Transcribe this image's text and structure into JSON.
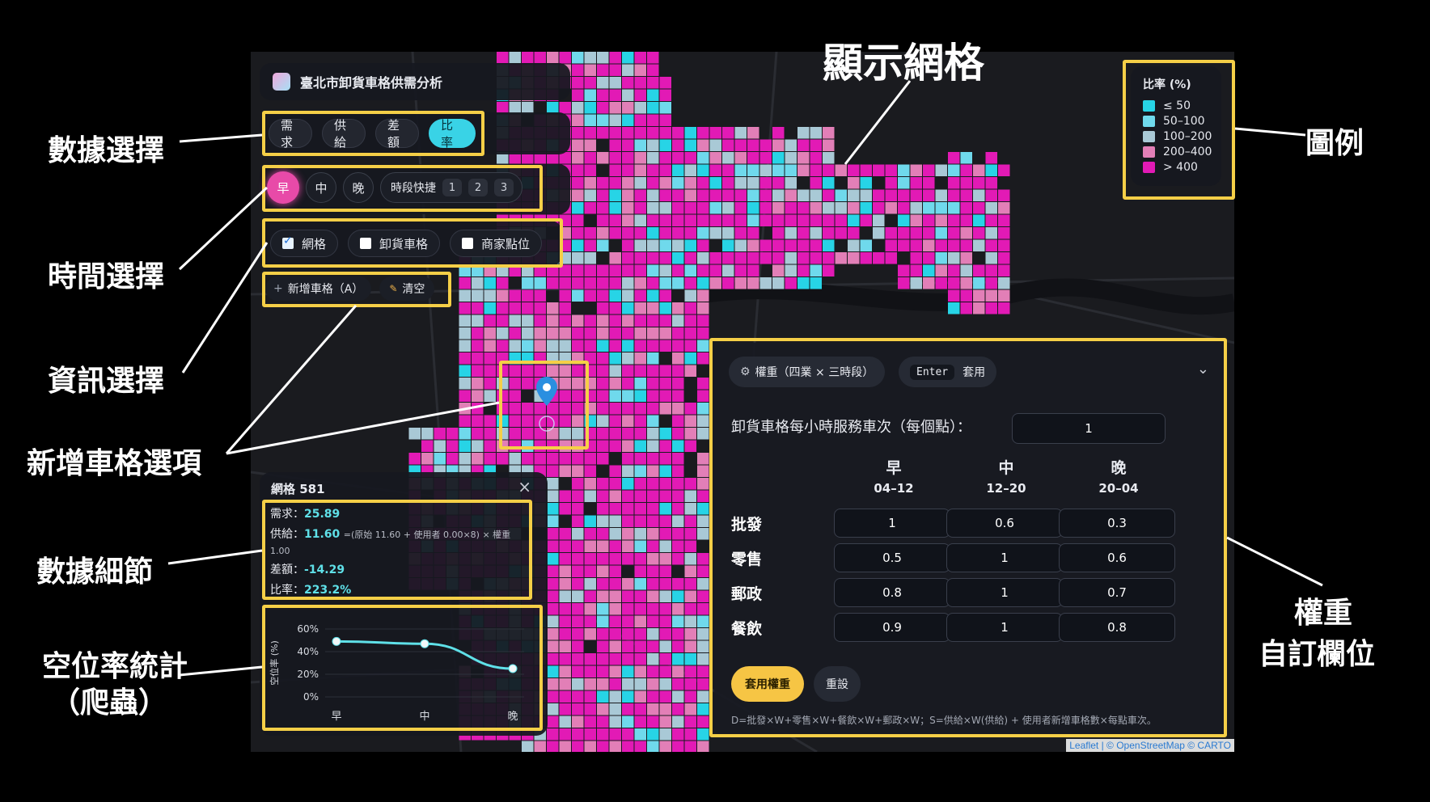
{
  "app": {
    "title": "臺北市卸貨車格供需分析"
  },
  "data_select": {
    "items": [
      "需求",
      "供給",
      "差額",
      "比率"
    ],
    "active_index": 3
  },
  "time_select": {
    "items": [
      "早",
      "中",
      "晚"
    ],
    "active_index": 0,
    "quick_label": "時段快捷",
    "quick_items": [
      "1",
      "2",
      "3"
    ]
  },
  "layers": [
    {
      "label": "網格",
      "checked": true
    },
    {
      "label": "卸貨車格",
      "checked": false
    },
    {
      "label": "商家點位",
      "checked": false
    }
  ],
  "actions": {
    "add": "新增車格（A）",
    "clear": "清空"
  },
  "legend": {
    "title": "比率 (%)",
    "items": [
      {
        "label": "≤ 50",
        "color": "#27d4e6"
      },
      {
        "label": "50–100",
        "color": "#6fd9ec"
      },
      {
        "label": "100–200",
        "color": "#a9c9d6"
      },
      {
        "label": "200–400",
        "color": "#e27fb7"
      },
      {
        "label": "> 400",
        "color": "#e21ab5"
      }
    ]
  },
  "cell_detail": {
    "title": "網格 581",
    "demand_label": "需求：",
    "demand_value": "25.89",
    "supply_label": "供給：",
    "supply_value": "11.60",
    "supply_note": "=(原始 11.60 + 使用者 0.00×8) × 權重",
    "supply_note2": "1.00",
    "diff_label": "差額：",
    "diff_value": "-14.29",
    "ratio_label": "比率：",
    "ratio_value": "223.2%"
  },
  "vacancy_chart": {
    "ylabel": "空位率 (%)",
    "yticks": [
      "60%",
      "40%",
      "20%",
      "0%"
    ],
    "chart_data": {
      "type": "line",
      "categories": [
        "早",
        "中",
        "晚"
      ],
      "values": [
        49,
        47,
        25
      ],
      "ylim": [
        0,
        60
      ],
      "ylabel": "空位率 (%)",
      "color": "#5fe0e8"
    }
  },
  "weights": {
    "header_label": "權重（四業 × 三時段）",
    "enter_key": "Enter",
    "apply_short": "套用",
    "service_label": "卸貨車格每小時服務車次（每個點）：",
    "service_value": "1",
    "columns": [
      {
        "name": "早",
        "range": "04–12"
      },
      {
        "name": "中",
        "range": "12–20"
      },
      {
        "name": "晚",
        "range": "20–04"
      }
    ],
    "rows": [
      {
        "label": "批發",
        "values": [
          "1",
          "0.6",
          "0.3"
        ]
      },
      {
        "label": "零售",
        "values": [
          "0.5",
          "1",
          "0.6"
        ]
      },
      {
        "label": "郵政",
        "values": [
          "0.8",
          "1",
          "0.7"
        ]
      },
      {
        "label": "餐飲",
        "values": [
          "0.9",
          "1",
          "0.8"
        ]
      }
    ],
    "apply_button": "套用權重",
    "reset_button": "重設",
    "formula": "D=批發×W+零售×W+餐飲×W+郵政×W；S=供給×W(供給) + 使用者新增車格數×每點車次。"
  },
  "attribution": "Leaflet | © OpenStreetMap © CARTO",
  "annotations": {
    "grid": "顯示網格",
    "legend": "圖例",
    "data_select": "數據選擇",
    "time_select": "時間選擇",
    "info_select": "資訊選擇",
    "add_space": "新增車格選項",
    "detail": "數據細節",
    "vacancy_line1": "空位率統計",
    "vacancy_line2": "（爬蟲）",
    "weight_line1": "權重",
    "weight_line2": "自訂欄位"
  }
}
